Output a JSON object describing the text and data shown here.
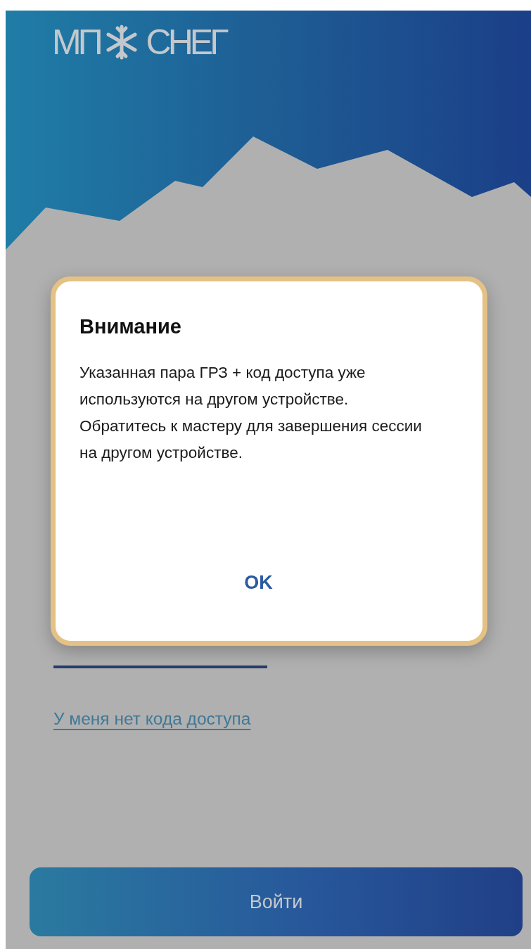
{
  "logo": {
    "left": "МП",
    "right": "СНЕГ"
  },
  "dialog": {
    "title": "Внимание",
    "message": "Указанная пара ГРЗ + код доступа уже используются на другом устройстве. Обратитесь к мастеру для завершения сессии на другом устройстве.",
    "button": "OK"
  },
  "no_code_link": "У меня нет кода доступа",
  "login_button": "Войти"
}
